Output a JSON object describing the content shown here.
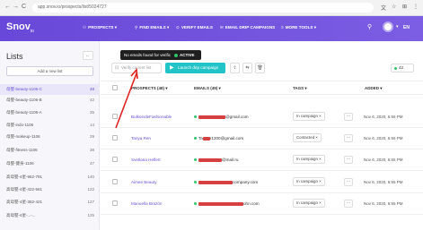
{
  "browser": {
    "url": "app.snov.io/prospects/list/5024727",
    "back": "←",
    "forward": "→",
    "reload": "C"
  },
  "app": {
    "logo": "Snov",
    "logo_sub": "io",
    "nav": [
      {
        "icon": "⚲",
        "label": "PROSPECTS"
      },
      {
        "icon": "⚲",
        "label": "FIND EMAILS"
      },
      {
        "icon": "⊙",
        "label": "VERIFY EMAILS"
      },
      {
        "icon": "✉",
        "label": "EMAIL DRIP CAMPAIGNS"
      },
      {
        "icon": "≡",
        "label": "MORE TOOLS"
      }
    ],
    "lang": "EN"
  },
  "sidebar": {
    "title": "Lists",
    "add_label": "Add a new list",
    "items": [
      {
        "name": "母婴-beauty-1106-C",
        "count": "48"
      },
      {
        "name": "母婴-beauty-1106-B",
        "count": "42"
      },
      {
        "name": "母婴-beauty-1106-A",
        "count": "35"
      },
      {
        "name": "母婴-indo-1106",
        "count": "14"
      },
      {
        "name": "母婴-makeup-1106",
        "count": "29"
      },
      {
        "name": "母婴-fitness-1106",
        "count": "38"
      },
      {
        "name": "母婴-健身-1106",
        "count": "47"
      },
      {
        "name": "高母婴-4星-962-791",
        "count": "140"
      },
      {
        "name": "高母婴-4星-422-561",
        "count": "122"
      },
      {
        "name": "高母婴-4星-382-421",
        "count": "127"
      },
      {
        "name": "高母婴-4星-...-...",
        "count": "125"
      }
    ]
  },
  "toolbar": {
    "tooltip": "No emails found for verification",
    "active_badge": "ACTIVE",
    "verify_label": "Verify current list",
    "launch_label": "Launch drip campaign",
    "count": "42"
  },
  "table": {
    "headers": {
      "prospects": "PROSPECTS (48)",
      "emails": "EMAILS (49)",
      "tags": "TAGS",
      "added": "ADDED"
    },
    "rows": [
      {
        "name": "BulkoindeFashionable",
        "email_prefix": "",
        "email_suffix": "@gmail.com",
        "tag": "In campaign ×",
        "date": "Nov 6, 2020, 6:56 PM"
      },
      {
        "name": "Tanya Ren",
        "email_prefix": "Ta",
        "email_suffix": "r1200@gmail.com",
        "tag": "Contacted ×",
        "date": "Nov 6, 2020, 6:56 PM"
      },
      {
        "name": "Svetlana Helfert",
        "email_prefix": "",
        "email_suffix": "@mail.ru",
        "tag": "In campaign ×",
        "date": "Nov 6, 2020, 6:55 PM"
      },
      {
        "name": "Aimee Beauty",
        "email_prefix": "",
        "email_suffix": "company.com",
        "tag": "In campaign ×",
        "date": "Nov 6, 2020, 6:55 PM"
      },
      {
        "name": "Manuella Brazón",
        "email_prefix": "",
        "email_suffix": "ohn.com",
        "tag": "In campaign ×",
        "date": "Nov 6, 2020, 6:55 PM"
      }
    ]
  }
}
